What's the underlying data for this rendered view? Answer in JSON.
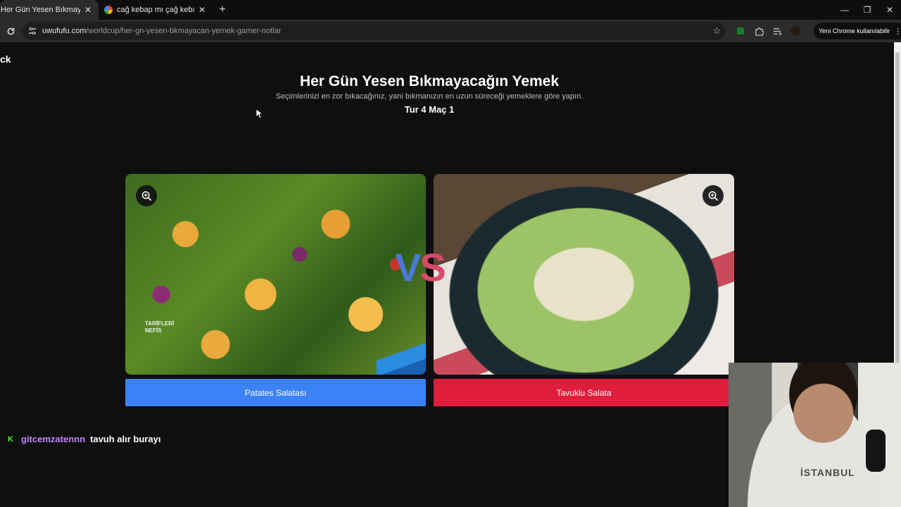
{
  "browser": {
    "tabs": [
      {
        "title": "Her Gün Yesen Bıkmayacağın Y",
        "active": true
      },
      {
        "title": "cağ kebap mı çağ kebap mı - G",
        "active": false
      }
    ],
    "new_tab": "+",
    "window_controls": {
      "minimize": "—",
      "restore": "❐",
      "close": "✕"
    },
    "url_host": "uwufufu.com",
    "url_path": "/worldcup/her-gn-yesen-bkmayacan-yemek-gamer-notlar",
    "update_label": "Yeni Chrome kullanılabilir"
  },
  "page": {
    "back_label": "ck",
    "title": "Her Gün Yesen Bıkmayacağın Yemek",
    "subtitle": "Seçimlerinizi en zor bıkacağınız, yani bıkmanızın en uzun süreceği yemeklere göre yapın.",
    "round_label": "Tur 4 Maç 1",
    "vs_v": "V",
    "vs_s": "S",
    "left_choice": {
      "label": "Patates Salatası",
      "watermark_line1": "TARİFLERİ",
      "watermark_line2": "NEFİS"
    },
    "right_choice": {
      "label": "Tavuklu Salata"
    },
    "colors": {
      "left_button": "#3b82f6",
      "right_button": "#e11d3c"
    }
  },
  "chat": {
    "username": "gitcemzatennn",
    "message": "tavuh alır burayı"
  },
  "webcam": {
    "shirt_text": "İSTANBUL"
  }
}
